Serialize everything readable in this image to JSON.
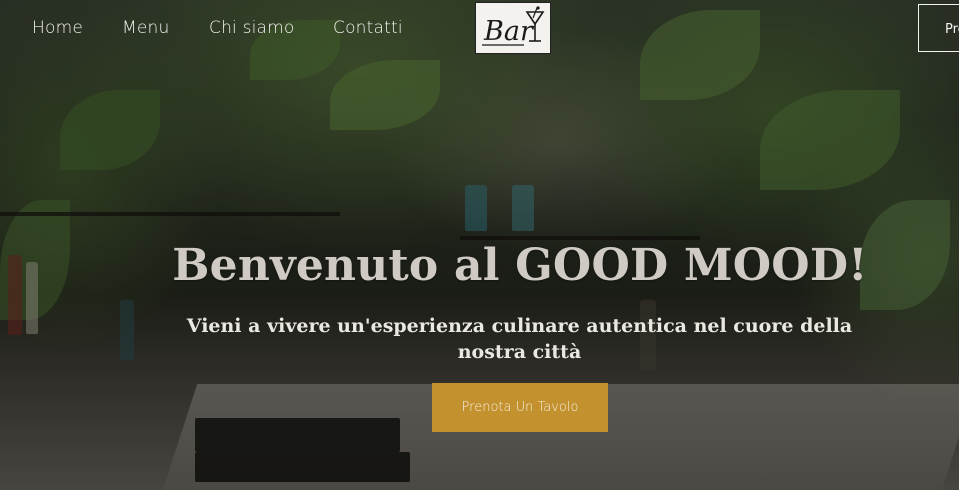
{
  "nav": {
    "links": [
      "Home",
      "Menu",
      "Chi siamo",
      "Contatti"
    ],
    "logo_text": "Bar",
    "cta_label": "Prenota"
  },
  "hero": {
    "headline": "Benvenuto al GOOD MOOD!",
    "subtitle": "Vieni a vivere un'esperienza culinare autentica nel cuore della nostra città",
    "cta_label": "Prenota Un Tavolo"
  },
  "colors": {
    "accent": "#c3912d",
    "nav_text": "#f2f2ee",
    "headline": "#cfcac4"
  },
  "icons": [
    "cocktail-glass-icon"
  ]
}
